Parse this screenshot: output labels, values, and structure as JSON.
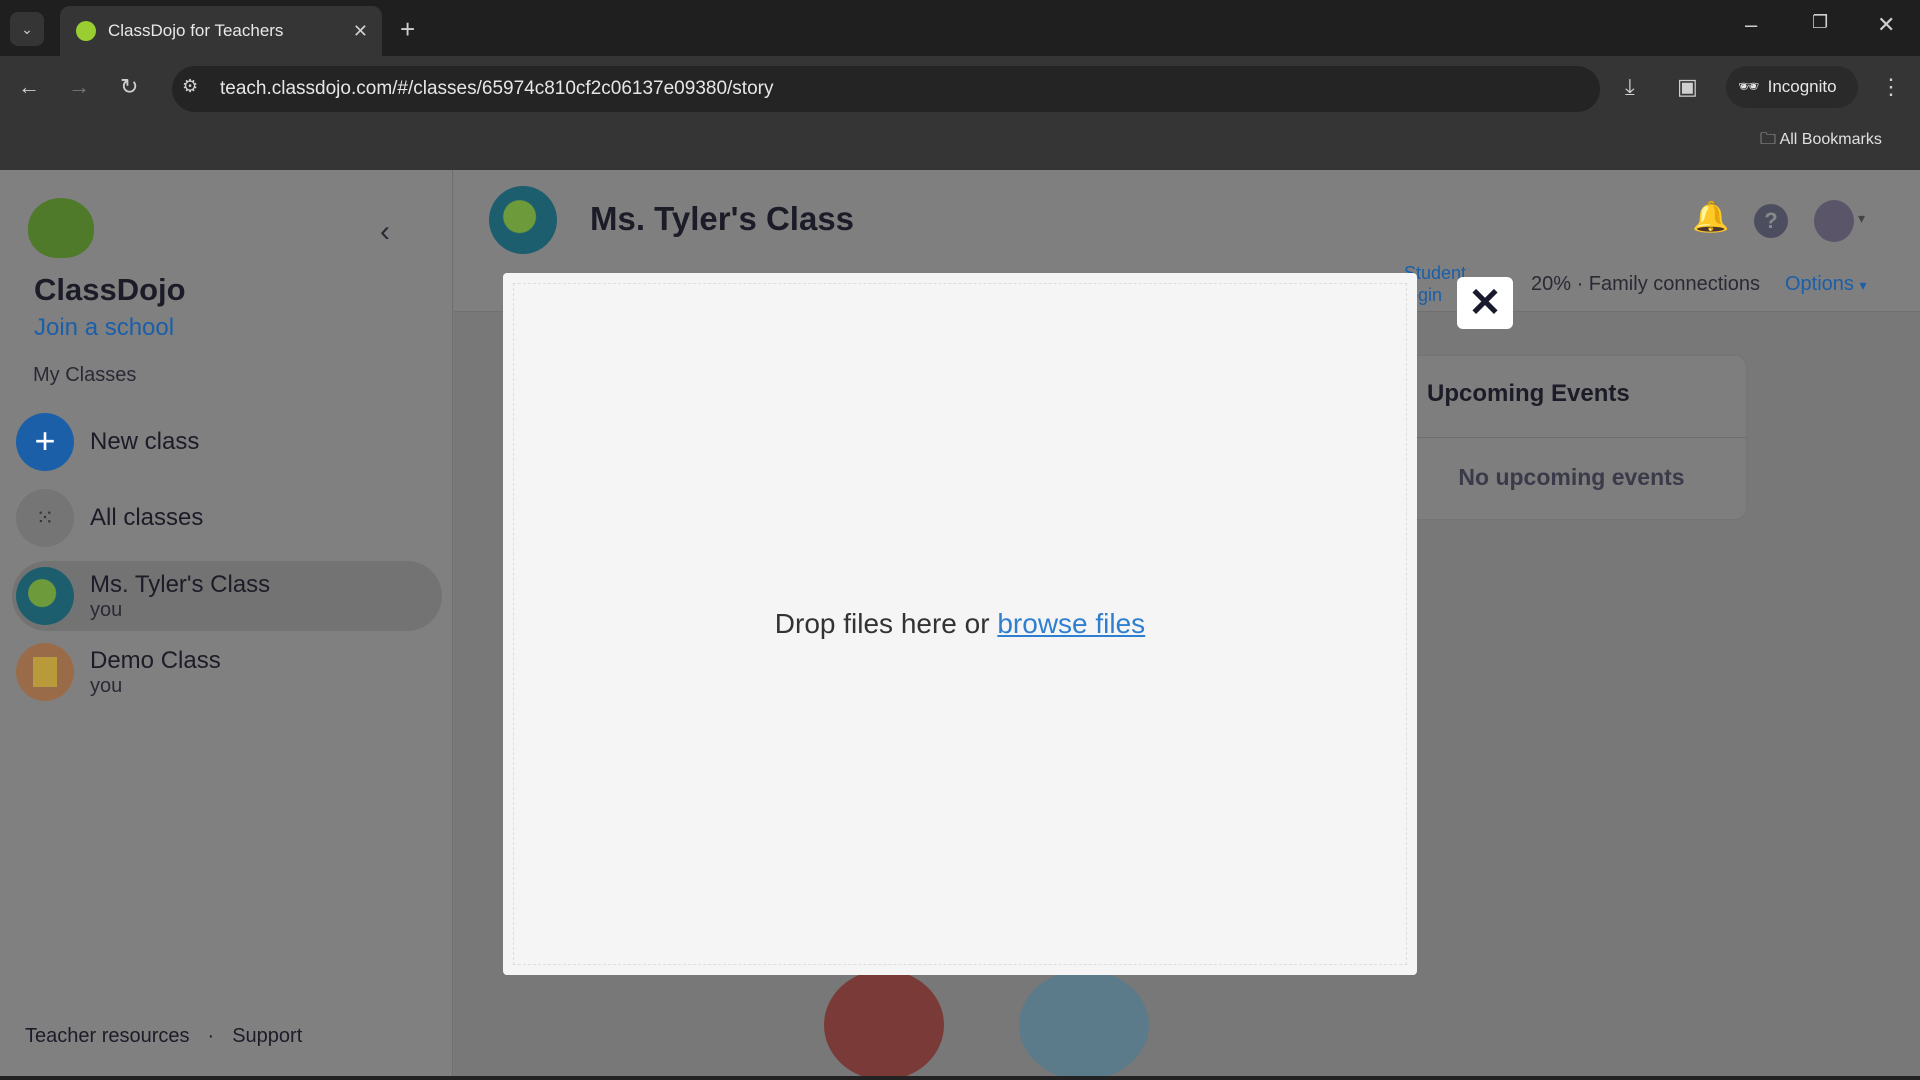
{
  "browser": {
    "tab_title": "ClassDojo for Teachers",
    "url": "teach.classdojo.com/#/classes/65974c810cf2c06137e09380/story",
    "incognito_label": "Incognito",
    "bookmarks_label": "All Bookmarks"
  },
  "sidebar": {
    "brand": "ClassDojo",
    "join_school": "Join a school",
    "section": "My Classes",
    "new_class": "New class",
    "all_classes": "All classes",
    "classes": [
      {
        "name": "Ms. Tyler's Class",
        "sub": "you"
      },
      {
        "name": "Demo Class",
        "sub": "you"
      }
    ],
    "footer": {
      "resources": "Teacher resources",
      "separator": "·",
      "support": "Support"
    }
  },
  "header": {
    "class_title": "Ms. Tyler's Class",
    "student_login": "Student login",
    "family_connections": "20% · Family connections",
    "options": "Options"
  },
  "events": {
    "title": "Upcoming Events",
    "empty": "No upcoming events"
  },
  "modal": {
    "drop_text": "Drop files here or ",
    "browse_link": "browse files",
    "close": "✕"
  },
  "colors": {
    "link": "#2f7fd1",
    "accent": "#1a6fc4"
  }
}
